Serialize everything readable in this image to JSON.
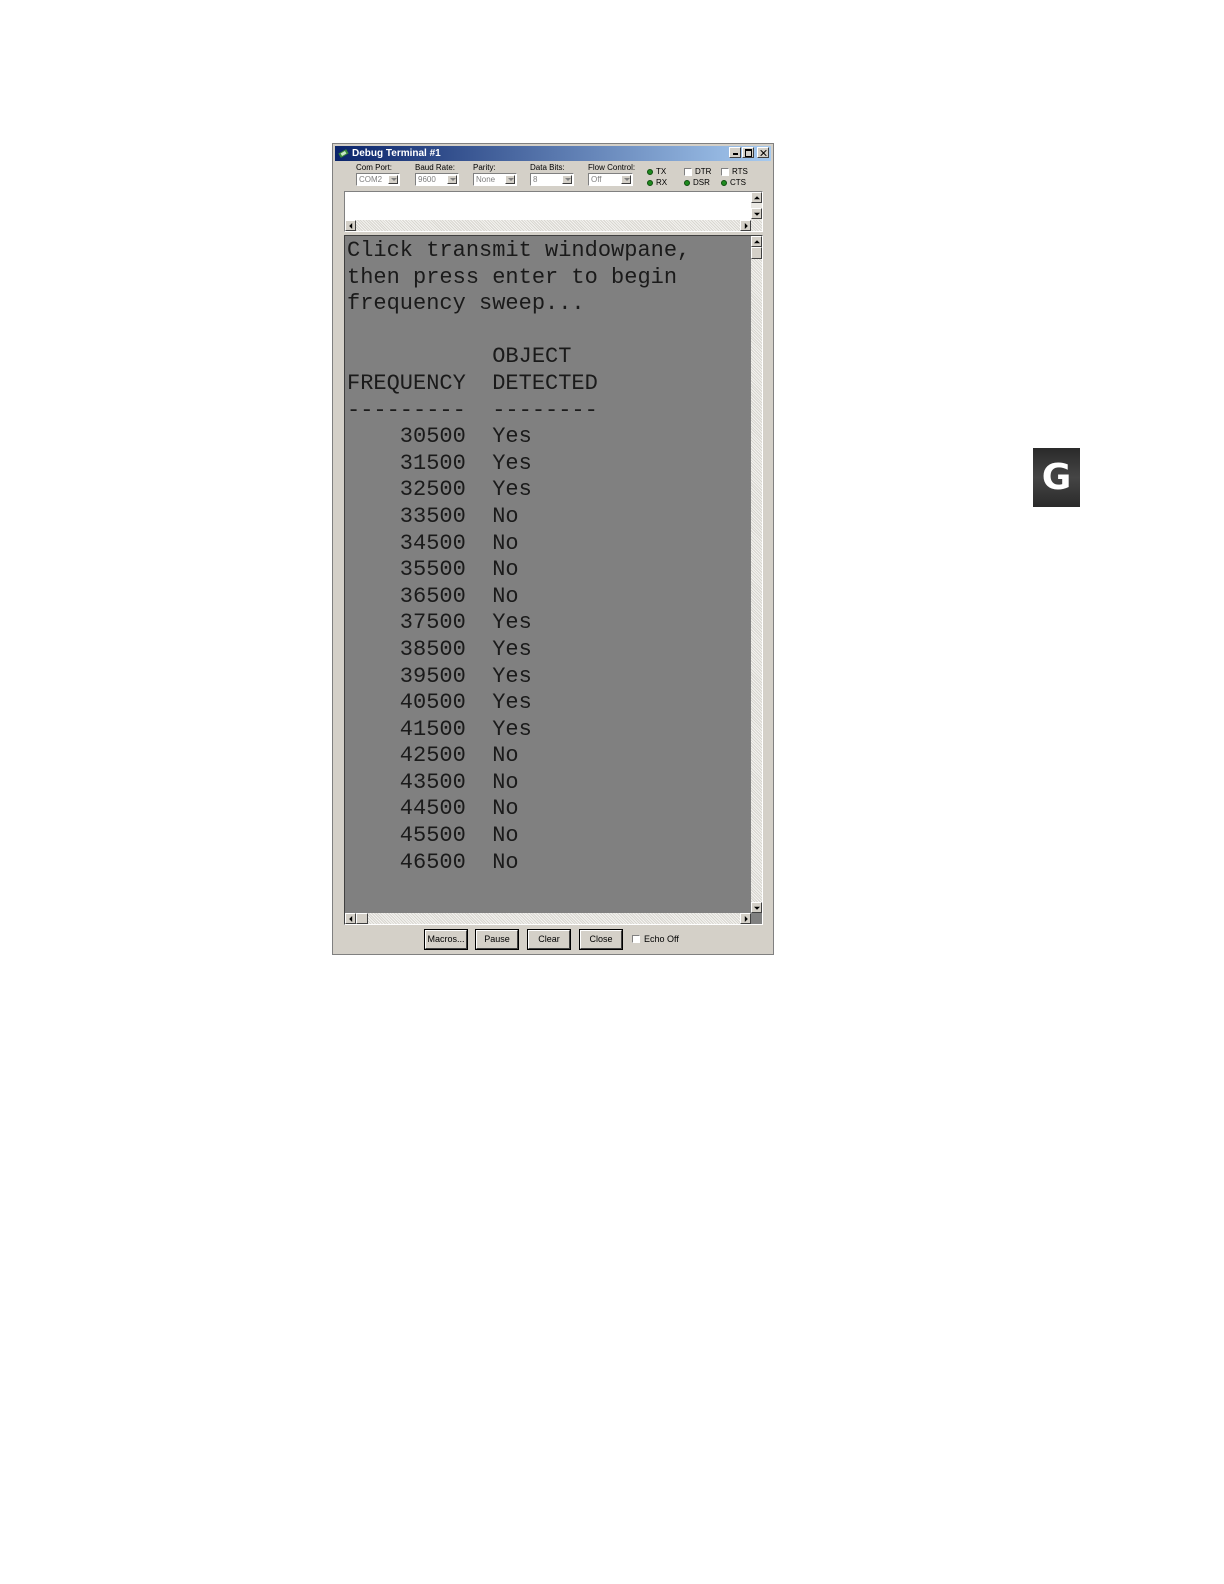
{
  "window": {
    "title": "Debug Terminal #1"
  },
  "settings": {
    "com_port": {
      "label": "Com Port:",
      "value": "COM2"
    },
    "baud_rate": {
      "label": "Baud Rate:",
      "value": "9600"
    },
    "parity": {
      "label": "Parity:",
      "value": "None"
    },
    "data_bits": {
      "label": "Data Bits:",
      "value": "8"
    },
    "flow_control": {
      "label": "Flow Control:",
      "value": "Off"
    }
  },
  "indicators": {
    "tx": "TX",
    "rx": "RX",
    "dtr": "DTR",
    "dsr": "DSR",
    "rts": "RTS",
    "cts": "CTS",
    "led_color": "#1f8a1f"
  },
  "receive": {
    "intro": [
      "Click transmit windowpane,",
      "then press enter to begin",
      "frequency sweep..."
    ],
    "header_line1": [
      "",
      "OBJECT"
    ],
    "header_line2": [
      "FREQUENCY",
      "DETECTED"
    ],
    "separator": [
      "---------",
      "--------"
    ],
    "rows": [
      [
        "30500",
        "Yes"
      ],
      [
        "31500",
        "Yes"
      ],
      [
        "32500",
        "Yes"
      ],
      [
        "33500",
        "No"
      ],
      [
        "34500",
        "No"
      ],
      [
        "35500",
        "No"
      ],
      [
        "36500",
        "No"
      ],
      [
        "37500",
        "Yes"
      ],
      [
        "38500",
        "Yes"
      ],
      [
        "39500",
        "Yes"
      ],
      [
        "40500",
        "Yes"
      ],
      [
        "41500",
        "Yes"
      ],
      [
        "42500",
        "No"
      ],
      [
        "43500",
        "No"
      ],
      [
        "44500",
        "No"
      ],
      [
        "45500",
        "No"
      ],
      [
        "46500",
        "No"
      ]
    ],
    "background": "#808080"
  },
  "buttons": {
    "macros": "Macros...",
    "pause": "Pause",
    "clear": "Clear",
    "close": "Close",
    "echo_off": "Echo Off"
  },
  "side_tab": {
    "letter": "G"
  }
}
